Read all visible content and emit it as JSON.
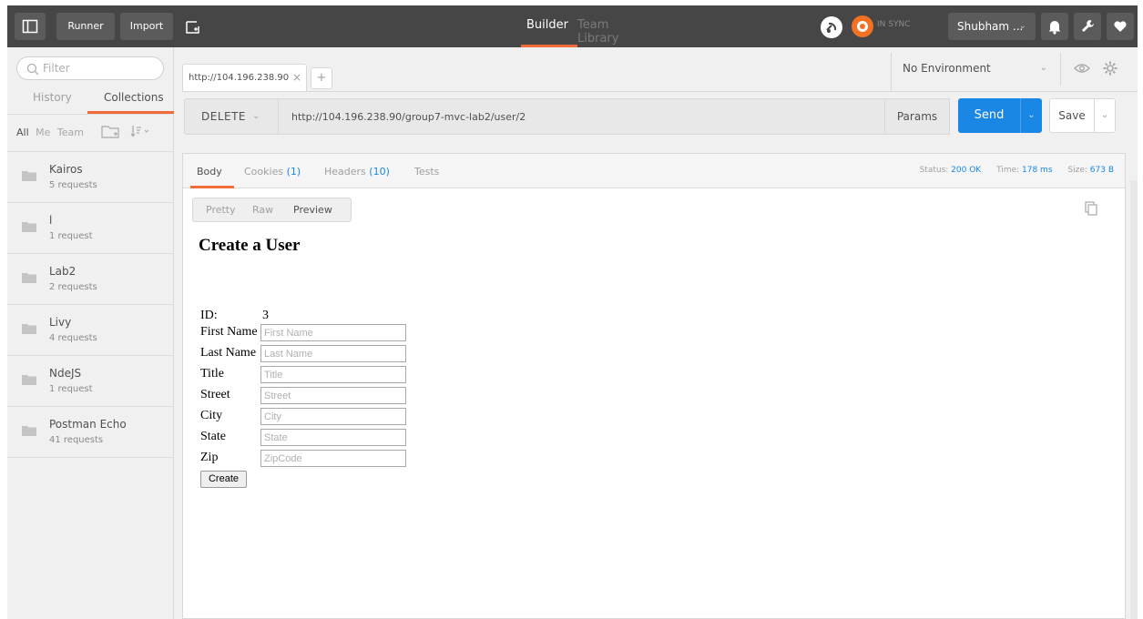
{
  "topbar": {
    "runner_label": "Runner",
    "import_label": "Import",
    "tabs": [
      {
        "label": "Builder",
        "active": true
      },
      {
        "label": "Team Library",
        "active": false
      }
    ],
    "sync_label": "IN SYNC",
    "user_label": "Shubham ...",
    "accent_color": "#f26b3a",
    "bar_color": "#464646"
  },
  "sidebar": {
    "filter_placeholder": "Filter",
    "tabs": [
      {
        "label": "History",
        "active": false
      },
      {
        "label": "Collections",
        "active": true
      }
    ],
    "scope_filters": [
      "All",
      "Me",
      "Team"
    ],
    "collections": [
      {
        "name": "Kairos",
        "count": "5 requests"
      },
      {
        "name": "l",
        "count": "1 request"
      },
      {
        "name": "Lab2",
        "count": "2 requests"
      },
      {
        "name": "Livy",
        "count": "4 requests"
      },
      {
        "name": "NdeJS",
        "count": "1 request"
      },
      {
        "name": "Postman Echo",
        "count": "41 requests"
      }
    ]
  },
  "request": {
    "tab_label": "http://104.196.238.90",
    "tab_close": "×",
    "add_tab": "+",
    "environment": "No Environment",
    "method": "DELETE",
    "url": "http://104.196.238.90/group7-mvc-lab2/user/2",
    "params_label": "Params",
    "send_label": "Send",
    "save_label": "Save",
    "send_color": "#1a87e5"
  },
  "response": {
    "tabs": {
      "body": "Body",
      "cookies": "Cookies",
      "cookies_count": "(1)",
      "headers": "Headers",
      "headers_count": "(10)",
      "tests": "Tests"
    },
    "status_label": "Status:",
    "status_value": "200 OK",
    "time_label": "Time:",
    "time_value": "178 ms",
    "size_label": "Size:",
    "size_value": "673 B",
    "view_modes": [
      "Pretty",
      "Raw",
      "Preview"
    ],
    "active_view": "Preview",
    "preview": {
      "heading": "Create a User",
      "id_label": "ID:",
      "id_value": "3",
      "fields": [
        {
          "label": "First Name",
          "placeholder": "First Name"
        },
        {
          "label": "Last Name",
          "placeholder": "Last Name"
        },
        {
          "label": "Title",
          "placeholder": "Title"
        },
        {
          "label": "Street",
          "placeholder": "Street"
        },
        {
          "label": "City",
          "placeholder": "City"
        },
        {
          "label": "State",
          "placeholder": "State"
        },
        {
          "label": "Zip",
          "placeholder": "ZipCode"
        }
      ],
      "submit_label": "Create"
    }
  }
}
